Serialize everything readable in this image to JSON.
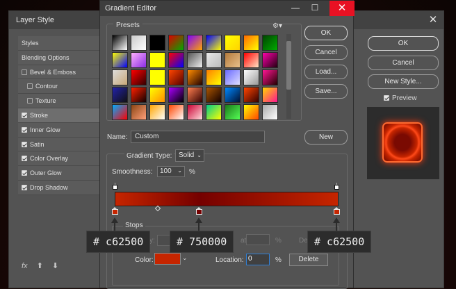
{
  "layer_style": {
    "title": "Layer Style",
    "sidebar": [
      {
        "label": "Styles",
        "check": "none"
      },
      {
        "label": "Blending Options",
        "check": "none"
      },
      {
        "label": "Bevel & Emboss",
        "check": "off"
      },
      {
        "label": "Contour",
        "check": "off",
        "indent": true
      },
      {
        "label": "Texture",
        "check": "off",
        "indent": true
      },
      {
        "label": "Stroke",
        "check": "on",
        "active": true
      },
      {
        "label": "Inner Glow",
        "check": "on"
      },
      {
        "label": "Satin",
        "check": "on"
      },
      {
        "label": "Color Overlay",
        "check": "on"
      },
      {
        "label": "Outer Glow",
        "check": "on"
      },
      {
        "label": "Drop Shadow",
        "check": "on"
      }
    ],
    "footer": {
      "fx": "fx"
    },
    "buttons": {
      "ok": "OK",
      "cancel": "Cancel",
      "new_style": "New Style..."
    },
    "preview_label": "Preview"
  },
  "gradient_editor": {
    "title": "Gradient Editor",
    "presets_label": "Presets",
    "buttons": {
      "ok": "OK",
      "cancel": "Cancel",
      "load": "Load...",
      "save": "Save...",
      "new": "New",
      "delete": "Delete"
    },
    "name_label": "Name:",
    "name_value": "Custom",
    "gradient_type_label": "Gradient Type:",
    "gradient_type_value": "Solid",
    "smoothness_label": "Smoothness:",
    "smoothness_value": "100",
    "percent": "%",
    "stops_label": "Stops",
    "opacity_partial": "ity:",
    "location_partial": "ation:",
    "delete_partial": "Del",
    "color_label": "Color:",
    "location_label": "Location:",
    "location_value": "0",
    "gradient_colors": [
      "#c62500",
      "#750000",
      "#c62500"
    ],
    "color_value": "#c62500"
  },
  "tooltips": [
    "# c62500",
    "# 750000",
    "# c62500"
  ]
}
